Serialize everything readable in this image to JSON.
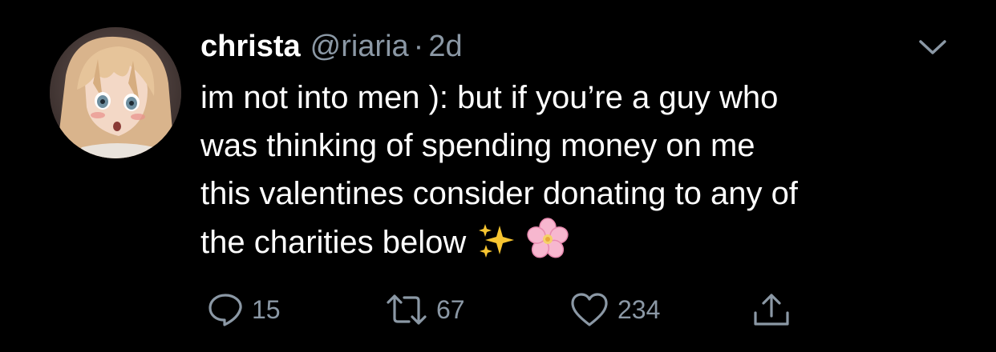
{
  "author": {
    "display_name": "christa",
    "handle": "@riaria",
    "separator": "·",
    "time": "2d"
  },
  "tweet": {
    "lines": [
      "im not into men ): but if you’re a guy who",
      "was thinking of spending money on me",
      "this valentines consider donating to any of",
      "the charities below"
    ],
    "emojis": [
      "sparkles-emoji",
      "cherry-blossom-emoji"
    ]
  },
  "actions": {
    "reply_count": "15",
    "retweet_count": "67",
    "like_count": "234"
  },
  "icons": {
    "reply": "reply-icon",
    "retweet": "retweet-icon",
    "like": "heart-icon",
    "share": "share-icon",
    "menu": "chevron-down-icon"
  },
  "colors": {
    "background": "#000000",
    "text": "#ffffff",
    "muted": "#8b98a5"
  }
}
